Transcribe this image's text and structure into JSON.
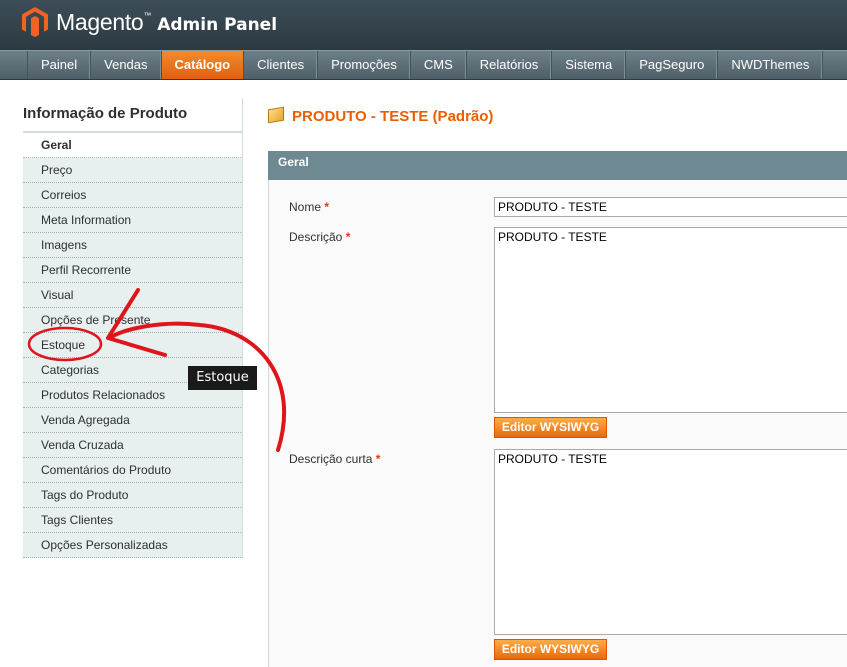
{
  "header": {
    "brand": "Magento",
    "brand_sub": "Admin Panel"
  },
  "nav": [
    {
      "label": "Painel",
      "active": false
    },
    {
      "label": "Vendas",
      "active": false
    },
    {
      "label": "Catálogo",
      "active": true
    },
    {
      "label": "Clientes",
      "active": false
    },
    {
      "label": "Promoções",
      "active": false
    },
    {
      "label": "CMS",
      "active": false
    },
    {
      "label": "Relatórios",
      "active": false
    },
    {
      "label": "Sistema",
      "active": false
    },
    {
      "label": "PagSeguro",
      "active": false
    },
    {
      "label": "NWDThemes",
      "active": false
    }
  ],
  "sidebar": {
    "title": "Informação de Produto",
    "items": [
      {
        "label": "Geral",
        "active": true
      },
      {
        "label": "Preço"
      },
      {
        "label": "Correios"
      },
      {
        "label": "Meta Information"
      },
      {
        "label": "Imagens"
      },
      {
        "label": "Perfil Recorrente"
      },
      {
        "label": "Visual"
      },
      {
        "label": "Opções de Presente"
      },
      {
        "label": "Estoque"
      },
      {
        "label": "Categorias"
      },
      {
        "label": "Produtos Relacionados"
      },
      {
        "label": "Venda Agregada"
      },
      {
        "label": "Venda Cruzada"
      },
      {
        "label": "Comentários do Produto"
      },
      {
        "label": "Tags do Produto"
      },
      {
        "label": "Tags Clientes"
      },
      {
        "label": "Opções Personalizadas"
      }
    ]
  },
  "main": {
    "title": "PRODUTO - TESTE (Padrão)",
    "section": "Geral",
    "fields": {
      "name": {
        "label": "Nome",
        "required": "*",
        "value": "PRODUTO - TESTE"
      },
      "description": {
        "label": "Descrição",
        "required": "*",
        "value": "PRODUTO - TESTE"
      },
      "short_description": {
        "label": "Descrição curta",
        "required": "*",
        "value": "PRODUTO - TESTE"
      }
    },
    "wysiwyg_label": "Editor WYSIWYG"
  },
  "tooltip": "Estoque",
  "colors": {
    "accent": "#eb5e00",
    "annotation": "#e0141a",
    "section_header": "#6f8992"
  }
}
